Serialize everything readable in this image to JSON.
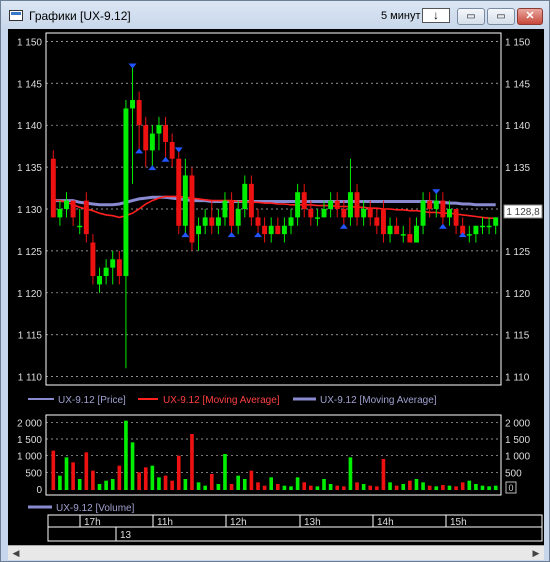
{
  "window": {
    "title": "Графики [UX-9.12]",
    "timeframe": "5 минут",
    "timeframe_button": "↓",
    "minimize_icon": "▭",
    "restore_icon": "▭",
    "close_icon": "✕"
  },
  "price_panel": {
    "y_ticks": [
      "1 150",
      "1 145",
      "1 140",
      "1 135",
      "1 130",
      "1 125",
      "1 120",
      "1 115",
      "1 110"
    ],
    "current_price": "1 128,8"
  },
  "legend": {
    "price": "UX-9.12 [Price]",
    "ma1": "UX-9.12 [Moving Average]",
    "ma2": "UX-9.12 [Moving Average]",
    "volume": "UX-9.12 [Volume]"
  },
  "volume_panel": {
    "y_ticks": [
      "2 000",
      "1 500",
      "1 000",
      "500",
      "0"
    ],
    "right_label": "0"
  },
  "time_axis": {
    "labels": [
      "17h",
      "11h",
      "12h",
      "13h",
      "14h",
      "15h"
    ],
    "date_label": "13"
  },
  "colors": {
    "up": "#00ee00",
    "down": "#ee1111",
    "ma_red": "#ff2020",
    "ma_blue": "#8a8ad0",
    "grid": "#ffffff",
    "marker": "#2255ff"
  },
  "chart_data": {
    "type": "candlestick",
    "ylim": [
      1109,
      1151
    ],
    "volume_ylim": [
      0,
      2100
    ],
    "candles": [
      {
        "o": 1136,
        "h": 1137,
        "l": 1129,
        "c": 1129
      },
      {
        "o": 1129,
        "h": 1131,
        "l": 1128,
        "c": 1130
      },
      {
        "o": 1130,
        "h": 1132,
        "l": 1129,
        "c": 1131
      },
      {
        "o": 1131,
        "h": 1131,
        "l": 1128,
        "c": 1129
      },
      {
        "o": 1128,
        "h": 1130,
        "l": 1127,
        "c": 1128
      },
      {
        "o": 1131,
        "h": 1132,
        "l": 1126,
        "c": 1127
      },
      {
        "o": 1126,
        "h": 1127,
        "l": 1121,
        "c": 1122
      },
      {
        "o": 1121,
        "h": 1123,
        "l": 1120,
        "c": 1122
      },
      {
        "o": 1122,
        "h": 1124,
        "l": 1121,
        "c": 1123
      },
      {
        "o": 1123,
        "h": 1125,
        "l": 1121,
        "c": 1124
      },
      {
        "o": 1124,
        "h": 1125,
        "l": 1121,
        "c": 1122
      },
      {
        "o": 1122,
        "h": 1143,
        "l": 1111,
        "c": 1142
      },
      {
        "o": 1142,
        "h": 1147,
        "l": 1133,
        "c": 1143
      },
      {
        "o": 1143,
        "h": 1144,
        "l": 1137,
        "c": 1140
      },
      {
        "o": 1140,
        "h": 1141,
        "l": 1135,
        "c": 1137
      },
      {
        "o": 1137,
        "h": 1140,
        "l": 1135,
        "c": 1139
      },
      {
        "o": 1139,
        "h": 1141,
        "l": 1137,
        "c": 1140
      },
      {
        "o": 1140,
        "h": 1141,
        "l": 1136,
        "c": 1138
      },
      {
        "o": 1138,
        "h": 1139,
        "l": 1135,
        "c": 1136
      },
      {
        "o": 1136,
        "h": 1137,
        "l": 1127,
        "c": 1128
      },
      {
        "o": 1128,
        "h": 1136,
        "l": 1127,
        "c": 1134
      },
      {
        "o": 1134,
        "h": 1135,
        "l": 1125,
        "c": 1126
      },
      {
        "o": 1127,
        "h": 1129,
        "l": 1125,
        "c": 1128
      },
      {
        "o": 1128,
        "h": 1130,
        "l": 1127,
        "c": 1129
      },
      {
        "o": 1129,
        "h": 1131,
        "l": 1127,
        "c": 1128
      },
      {
        "o": 1128,
        "h": 1130,
        "l": 1127,
        "c": 1129
      },
      {
        "o": 1129,
        "h": 1132,
        "l": 1128,
        "c": 1131
      },
      {
        "o": 1131,
        "h": 1132,
        "l": 1127,
        "c": 1128
      },
      {
        "o": 1128,
        "h": 1131,
        "l": 1127,
        "c": 1130
      },
      {
        "o": 1130,
        "h": 1134,
        "l": 1129,
        "c": 1133
      },
      {
        "o": 1133,
        "h": 1134,
        "l": 1128,
        "c": 1129
      },
      {
        "o": 1129,
        "h": 1130,
        "l": 1127,
        "c": 1128
      },
      {
        "o": 1128,
        "h": 1129,
        "l": 1126,
        "c": 1127
      },
      {
        "o": 1127,
        "h": 1129,
        "l": 1126,
        "c": 1128
      },
      {
        "o": 1128,
        "h": 1129,
        "l": 1127,
        "c": 1127
      },
      {
        "o": 1127,
        "h": 1129,
        "l": 1126,
        "c": 1128
      },
      {
        "o": 1128,
        "h": 1130,
        "l": 1127,
        "c": 1129
      },
      {
        "o": 1129,
        "h": 1133,
        "l": 1128,
        "c": 1132
      },
      {
        "o": 1132,
        "h": 1133,
        "l": 1129,
        "c": 1130
      },
      {
        "o": 1130,
        "h": 1131,
        "l": 1128,
        "c": 1129
      },
      {
        "o": 1129,
        "h": 1130,
        "l": 1128,
        "c": 1129
      },
      {
        "o": 1129,
        "h": 1131,
        "l": 1129,
        "c": 1130
      },
      {
        "o": 1130,
        "h": 1132,
        "l": 1129,
        "c": 1131
      },
      {
        "o": 1131,
        "h": 1132,
        "l": 1129,
        "c": 1130
      },
      {
        "o": 1130,
        "h": 1131,
        "l": 1128,
        "c": 1129
      },
      {
        "o": 1129,
        "h": 1136,
        "l": 1128,
        "c": 1132
      },
      {
        "o": 1132,
        "h": 1133,
        "l": 1128,
        "c": 1129
      },
      {
        "o": 1129,
        "h": 1131,
        "l": 1128,
        "c": 1130
      },
      {
        "o": 1130,
        "h": 1131,
        "l": 1128,
        "c": 1129
      },
      {
        "o": 1129,
        "h": 1130,
        "l": 1127,
        "c": 1128
      },
      {
        "o": 1130,
        "h": 1131,
        "l": 1126,
        "c": 1127
      },
      {
        "o": 1127,
        "h": 1129,
        "l": 1126,
        "c": 1128
      },
      {
        "o": 1128,
        "h": 1129,
        "l": 1127,
        "c": 1127
      },
      {
        "o": 1127,
        "h": 1128,
        "l": 1126,
        "c": 1127
      },
      {
        "o": 1127,
        "h": 1129,
        "l": 1126,
        "c": 1126
      },
      {
        "o": 1126,
        "h": 1129,
        "l": 1126,
        "c": 1128
      },
      {
        "o": 1128,
        "h": 1132,
        "l": 1127,
        "c": 1131
      },
      {
        "o": 1131,
        "h": 1132,
        "l": 1129,
        "c": 1130
      },
      {
        "o": 1130,
        "h": 1132,
        "l": 1129,
        "c": 1131
      },
      {
        "o": 1131,
        "h": 1132,
        "l": 1128,
        "c": 1129
      },
      {
        "o": 1129,
        "h": 1131,
        "l": 1128,
        "c": 1130
      },
      {
        "o": 1130,
        "h": 1130,
        "l": 1127,
        "c": 1128
      },
      {
        "o": 1128,
        "h": 1129,
        "l": 1127,
        "c": 1127
      },
      {
        "o": 1127,
        "h": 1128,
        "l": 1126,
        "c": 1127
      },
      {
        "o": 1127,
        "h": 1128,
        "l": 1126,
        "c": 1128
      },
      {
        "o": 1128,
        "h": 1129,
        "l": 1127,
        "c": 1128
      },
      {
        "o": 1128,
        "h": 1129,
        "l": 1127,
        "c": 1128
      },
      {
        "o": 1128,
        "h": 1129,
        "l": 1127,
        "c": 1129
      }
    ],
    "volumes": [
      1150,
      400,
      950,
      800,
      300,
      1100,
      550,
      150,
      250,
      300,
      700,
      2050,
      1400,
      500,
      650,
      700,
      350,
      400,
      250,
      1000,
      300,
      1650,
      200,
      100,
      450,
      150,
      1050,
      150,
      400,
      300,
      550,
      200,
      100,
      350,
      150,
      100,
      80,
      350,
      200,
      100,
      80,
      300,
      150,
      100,
      80,
      950,
      200,
      150,
      100,
      80,
      900,
      200,
      100,
      150,
      250,
      300,
      200,
      100,
      80,
      120,
      100,
      80,
      200,
      250,
      150,
      100,
      80,
      100
    ],
    "ma_red": [
      1131,
      1131,
      1130.8,
      1130.5,
      1130.2,
      1130,
      1129.8,
      1129.5,
      1129.3,
      1129.2,
      1129,
      1129.2,
      1129.5,
      1130,
      1130.6,
      1131,
      1131.3,
      1131.5,
      1131.5,
      1131.5,
      1131.4,
      1131.3,
      1131.2,
      1131.1,
      1131,
      1131,
      1131,
      1131,
      1130.9,
      1130.9,
      1130.8,
      1130.8,
      1130.7,
      1130.7,
      1130.6,
      1130.6,
      1130.5,
      1130.5,
      1130.5,
      1130.5,
      1130.4,
      1130.4,
      1130.4,
      1130.3,
      1130.3,
      1130.3,
      1130.2,
      1130.2,
      1130.1,
      1130.1,
      1130,
      1130,
      1129.9,
      1129.9,
      1129.8,
      1129.8,
      1129.7,
      1129.6,
      1129.6,
      1129.5,
      1129.5,
      1129.4,
      1129.3,
      1129.2,
      1129.1,
      1129,
      1128.9,
      1128.9
    ],
    "ma_blue": [
      1131,
      1131,
      1131,
      1131,
      1130.8,
      1130.7,
      1130.6,
      1130.5,
      1130.5,
      1130.5,
      1130.6,
      1130.8,
      1131,
      1131.2,
      1131.3,
      1131.4,
      1131.4,
      1131.4,
      1131.3,
      1131.2,
      1131.1,
      1131,
      1131,
      1131,
      1130.9,
      1130.9,
      1130.9,
      1130.9,
      1130.9,
      1130.9,
      1130.9,
      1130.9,
      1130.9,
      1130.9,
      1130.9,
      1130.9,
      1130.9,
      1130.9,
      1130.9,
      1130.9,
      1130.9,
      1130.9,
      1130.9,
      1130.9,
      1130.9,
      1130.9,
      1130.9,
      1130.9,
      1130.9,
      1130.9,
      1130.9,
      1130.9,
      1130.9,
      1130.9,
      1130.9,
      1130.9,
      1130.9,
      1130.9,
      1130.8,
      1130.8,
      1130.7,
      1130.7,
      1130.6,
      1130.6,
      1130.5,
      1130.5,
      1130.5,
      1130.5
    ],
    "markers": [
      {
        "i": 12,
        "kind": "up"
      },
      {
        "i": 13,
        "kind": "down"
      },
      {
        "i": 15,
        "kind": "down"
      },
      {
        "i": 17,
        "kind": "down"
      },
      {
        "i": 19,
        "kind": "up"
      },
      {
        "i": 20,
        "kind": "down"
      },
      {
        "i": 27,
        "kind": "down"
      },
      {
        "i": 31,
        "kind": "down"
      },
      {
        "i": 44,
        "kind": "down"
      },
      {
        "i": 58,
        "kind": "up"
      },
      {
        "i": 59,
        "kind": "down"
      },
      {
        "i": 62,
        "kind": "down"
      }
    ]
  }
}
